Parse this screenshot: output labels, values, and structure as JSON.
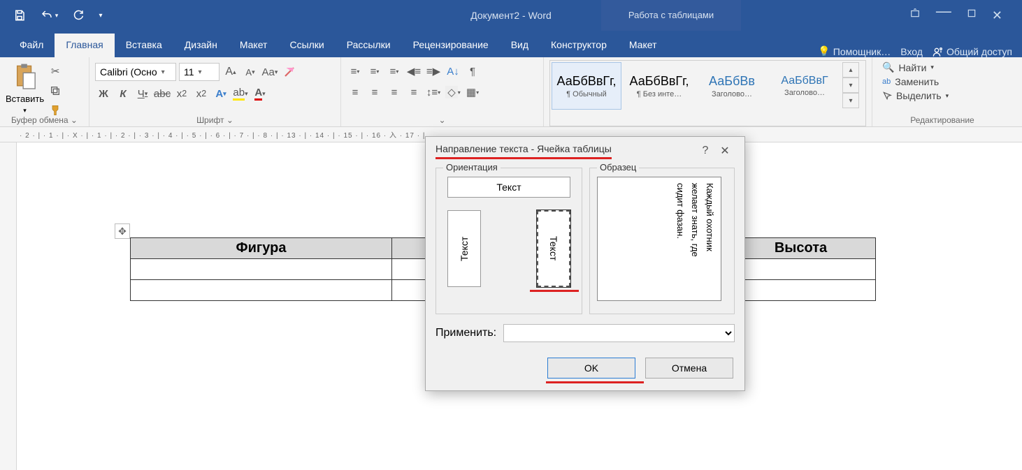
{
  "titlebar": {
    "document_title": "Документ2 - Word",
    "tools_context": "Работа с таблицами"
  },
  "tabs": {
    "file": "Файл",
    "home": "Главная",
    "insert": "Вставка",
    "design": "Дизайн",
    "layout": "Макет",
    "references": "Ссылки",
    "mailings": "Рассылки",
    "review": "Рецензирование",
    "view": "Вид",
    "table_design": "Конструктор",
    "table_layout": "Макет",
    "tell_me": "Помощник…",
    "sign_in": "Вход",
    "share": "Общий доступ"
  },
  "groups": {
    "clipboard": {
      "label": "Буфер обмена",
      "paste": "Вставить"
    },
    "font": {
      "label": "Шрифт",
      "name": "Calibri (Осно",
      "size": "11"
    },
    "paragraph": {
      "label": ""
    },
    "styles": {
      "label": "",
      "s1": {
        "preview": "АаБбВвГг,",
        "name": "¶ Обычный"
      },
      "s2": {
        "preview": "АаБбВвГг,",
        "name": "¶ Без инте…"
      },
      "s3": {
        "preview": "АаБбВв",
        "name": "Заголово…"
      },
      "s4": {
        "preview": "АаБбВвГ",
        "name": "Заголово…"
      }
    },
    "editing": {
      "label": "Редактирование",
      "find": "Найти",
      "replace": "Заменить",
      "select": "Выделить"
    }
  },
  "ruler_h": "· 2 · | · 1 · | · X · | · 1 · | · 2 · | · 3 · | · 4 · | · 5 · | · 6 · | · 7 · | · 8 · |               · 13 · | · 14 · | · 15 · | · 16 · 入 · 17 · |",
  "table": {
    "col1": "Фигура",
    "col2": "Высота"
  },
  "dialog": {
    "title": "Направление текста - Ячейка таблицы",
    "orientation_label": "Ориентация",
    "sample_label": "Образец",
    "text": "Текст",
    "sample_l1": "Каждый охотник",
    "sample_l2": "желает знать, где",
    "sample_l3": "сидит фазан.",
    "apply_label": "Применить:",
    "ok": "OK",
    "cancel": "Отмена"
  }
}
